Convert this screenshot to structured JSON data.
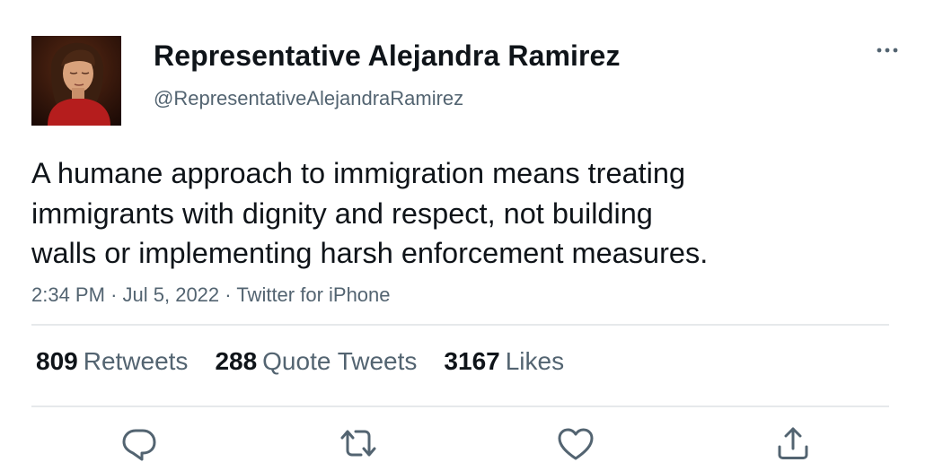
{
  "author": {
    "display_name": "Representative Alejandra Ramirez",
    "handle": "@RepresentativeAlejandraRamirez"
  },
  "tweet": {
    "text_lines": [
      "A humane approach to immigration means treating",
      "immigrants with dignity and respect, not building",
      "walls or implementing harsh enforcement measures."
    ],
    "time": "2:34 PM",
    "date": "Jul 5, 2022",
    "source": "Twitter for iPhone",
    "separator": "·"
  },
  "stats": {
    "retweets": {
      "count": "809",
      "label": "Retweets"
    },
    "quote_tweets": {
      "count": "288",
      "label": "Quote Tweets"
    },
    "likes": {
      "count": "3167",
      "label": "Likes"
    }
  },
  "actions": {
    "reply_icon": "reply-icon",
    "retweet_icon": "retweet-icon",
    "like_icon": "heart-icon",
    "share_icon": "share-icon",
    "more_icon": "more-dots-icon"
  },
  "colors": {
    "primary_text": "#0f1419",
    "secondary_text": "#536471",
    "divider": "#e6e9eb"
  }
}
